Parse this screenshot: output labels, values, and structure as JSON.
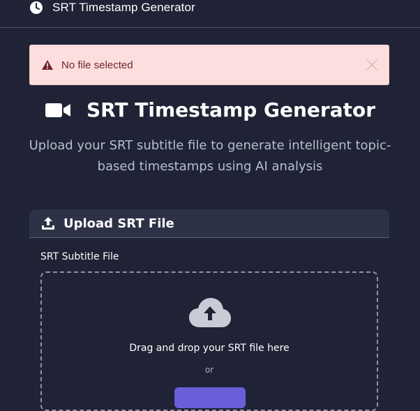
{
  "app": {
    "title": "SRT Timestamp Generator",
    "icon": "clock-icon"
  },
  "alert": {
    "message": "No file selected",
    "icon": "warning-icon",
    "close_icon": "close-icon",
    "background": "#fcdede",
    "text_color": "#6e2428"
  },
  "hero": {
    "icon": "video-camera-icon",
    "title": "SRT Timestamp Generator",
    "subtitle": "Upload your SRT subtitle file to generate intelligent topic-based timestamps using AI analysis"
  },
  "upload_panel": {
    "icon": "upload-icon",
    "title": "Upload SRT File",
    "field_label": "SRT Subtitle File",
    "dropzone": {
      "icon": "cloud-upload-icon",
      "text": "Drag and drop your SRT file here",
      "or_text": "or"
    }
  },
  "colors": {
    "background": "#1f2335",
    "panel_header": "#2d3246",
    "accent": "#6a5ed9"
  }
}
